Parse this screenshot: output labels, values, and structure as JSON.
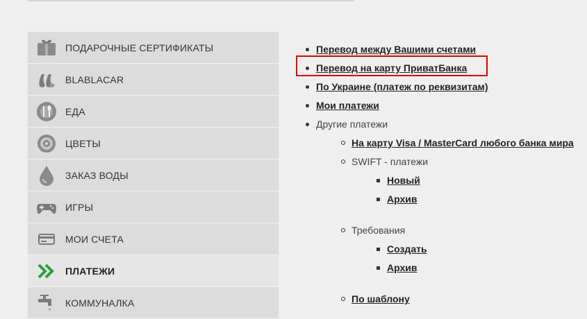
{
  "sidebar": {
    "items": [
      {
        "label": "ПОДАРОЧНЫЕ СЕРТИФИКАТЫ",
        "icon": "gift-certificate-icon",
        "active": false
      },
      {
        "label": "BLABLACAR",
        "icon": "blablacar-icon",
        "active": false
      },
      {
        "label": "ЕДА",
        "icon": "food-icon",
        "active": false
      },
      {
        "label": "ЦВЕТЫ",
        "icon": "flower-icon",
        "active": false
      },
      {
        "label": "ЗАКАЗ ВОДЫ",
        "icon": "water-drop-icon",
        "active": false
      },
      {
        "label": "ИГРЫ",
        "icon": "gamepad-icon",
        "active": false
      },
      {
        "label": "МОИ СЧЕТА",
        "icon": "card-icon",
        "active": false
      },
      {
        "label": "ПЛАТЕЖИ",
        "icon": "double-chevron-icon",
        "active": true
      },
      {
        "label": "КОММУНАЛКА",
        "icon": "faucet-icon",
        "active": false
      }
    ]
  },
  "payments_menu": {
    "between_accounts": "Перевод между Вашими счетами",
    "to_privatbank_card": "Перевод на карту ПриватБанка",
    "ukraine_details": "По Украине (платеж по реквизитам)",
    "my_payments": "Мои платежи",
    "other_payments": "Другие платежи",
    "visa_mastercard": "На карту Visa / MasterCard любого банка мира",
    "swift": "SWIFT - платежи",
    "swift_new": "Новый",
    "swift_archive": "Архив",
    "requirements": "Требования",
    "req_create": "Создать",
    "req_archive": "Архив",
    "by_template": "По шаблону"
  },
  "colors": {
    "highlight_border": "#e00000",
    "sidebar_bg": "#dcdcdc",
    "active_icon": "#2e9e3e"
  }
}
